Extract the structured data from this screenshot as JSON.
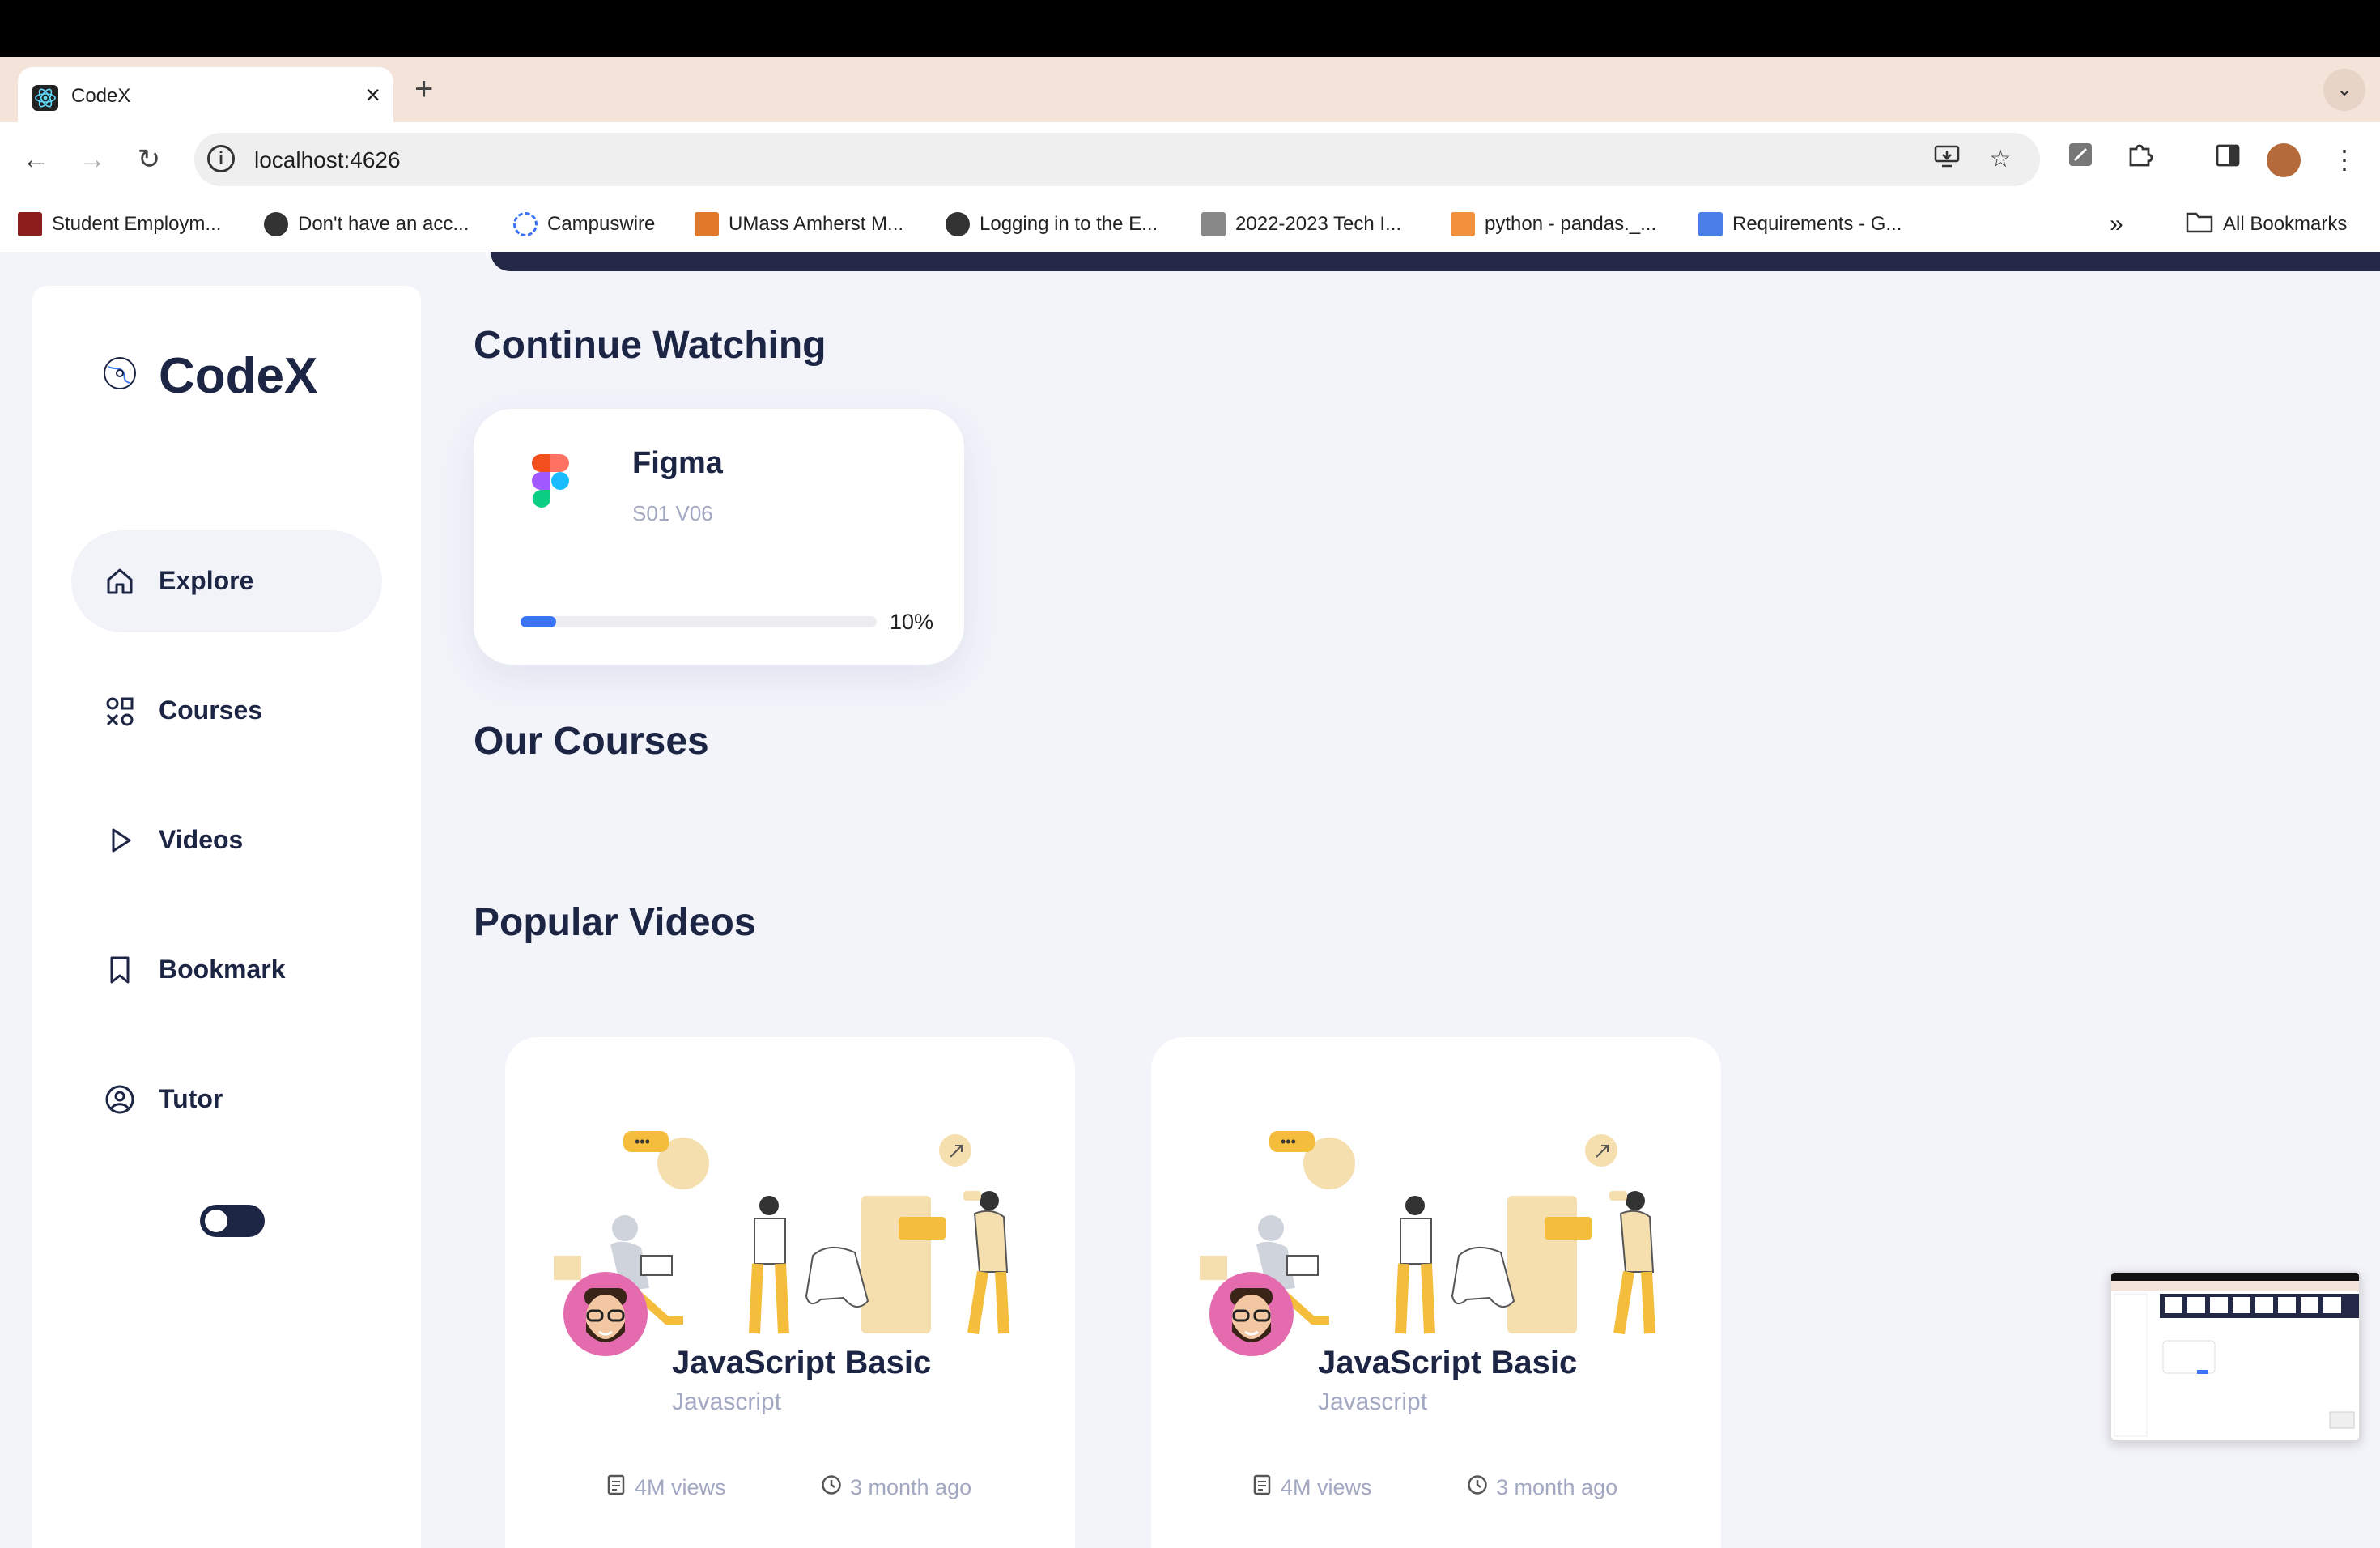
{
  "browser": {
    "tab_title": "CodeX",
    "url": "localhost:4626",
    "bookmarks": [
      {
        "label": "Student Employm...",
        "icon": "umass-m-icon"
      },
      {
        "label": "Don't have an acc...",
        "icon": "globe-icon"
      },
      {
        "label": "Campuswire",
        "icon": "campuswire-icon"
      },
      {
        "label": "UMass Amherst M...",
        "icon": "umass-icon"
      },
      {
        "label": "Logging in to the E...",
        "icon": "globe-icon"
      },
      {
        "label": "2022-2023 Tech I...",
        "icon": "chart-icon"
      },
      {
        "label": "python - pandas._...",
        "icon": "stackoverflow-icon"
      },
      {
        "label": "Requirements - G...",
        "icon": "docs-icon"
      }
    ],
    "all_bookmarks": "All Bookmarks"
  },
  "sidebar": {
    "brand": "CodeX",
    "items": [
      {
        "label": "Explore",
        "icon": "home-icon",
        "active": true
      },
      {
        "label": "Courses",
        "icon": "shapes-icon",
        "active": false
      },
      {
        "label": "Videos",
        "icon": "play-icon",
        "active": false
      },
      {
        "label": "Bookmark",
        "icon": "bookmark-icon",
        "active": false
      },
      {
        "label": "Tutor",
        "icon": "user-circle-icon",
        "active": false
      }
    ]
  },
  "main": {
    "continue_watching": {
      "title": "Continue Watching",
      "course": "Figma",
      "episode": "S01 V06",
      "progress_text": "10%",
      "progress": 0.1
    },
    "our_courses_title": "Our Courses",
    "popular_videos_title": "Popular Videos",
    "videos": [
      {
        "title": "JavaScript Basic",
        "category": "Javascript",
        "views": "4M views",
        "time": "3 month ago"
      },
      {
        "title": "JavaScript Basic",
        "category": "Javascript",
        "views": "4M views",
        "time": "3 month ago"
      }
    ]
  },
  "colors": {
    "navy": "#1d2545",
    "accent": "#3a73f3",
    "muted": "#a2a8c2",
    "background": "#f3f4fa"
  }
}
